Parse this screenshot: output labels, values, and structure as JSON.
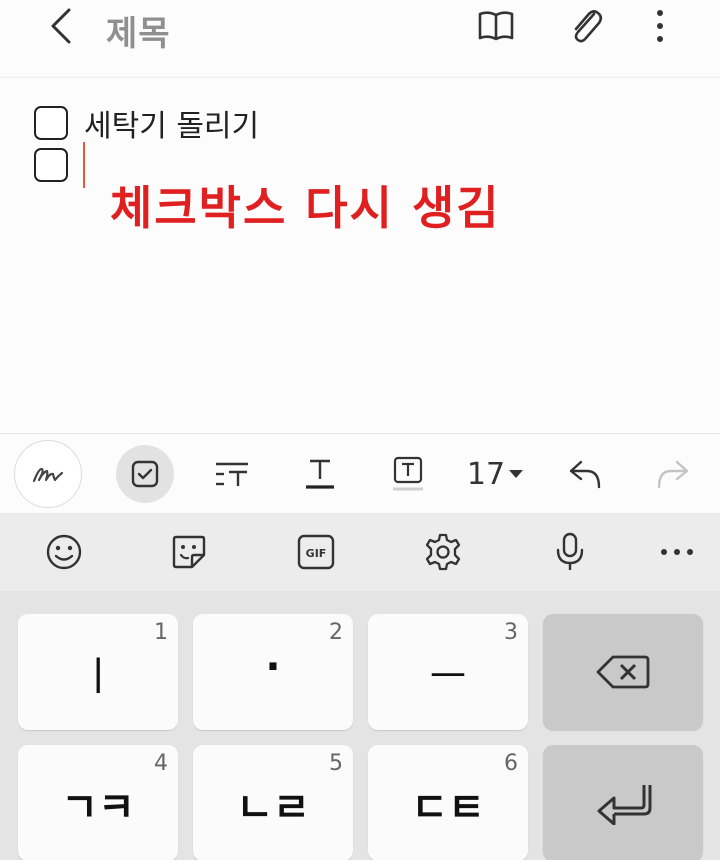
{
  "header": {
    "title": "제목"
  },
  "note": {
    "items": [
      {
        "checked": false,
        "text": "세탁기 돌리기"
      },
      {
        "checked": false,
        "text": ""
      }
    ],
    "annotation": "체크박스 다시 생김",
    "annotation_color": "#e02020"
  },
  "toolbar": {
    "font_size": "17"
  },
  "keyboard": {
    "top_row": [
      "emoji-icon",
      "sticker-icon",
      "gif-icon",
      "settings-icon",
      "microphone-icon",
      "more-icon"
    ],
    "gif_label": "GIF",
    "keys": [
      {
        "glyph": "ㅣ",
        "num": "1"
      },
      {
        "glyph": "·",
        "num": "2"
      },
      {
        "glyph": "ㅡ",
        "num": "3"
      },
      {
        "glyph": "ㄱㅋ",
        "num": "4"
      },
      {
        "glyph": "ㄴㄹ",
        "num": "5"
      },
      {
        "glyph": "ㄷㅌ",
        "num": "6"
      }
    ]
  }
}
